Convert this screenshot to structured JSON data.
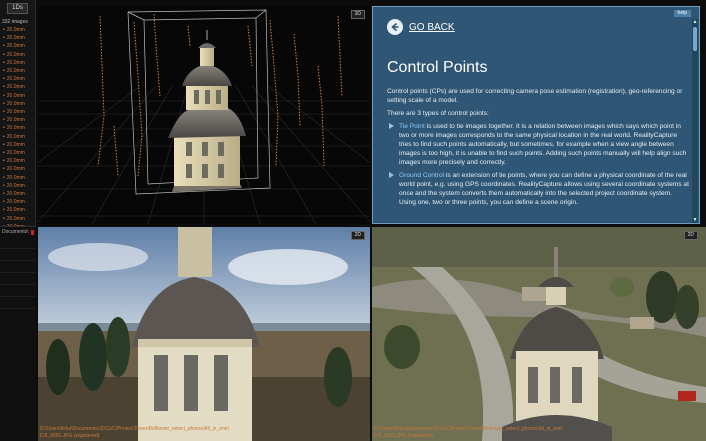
{
  "left_panel": {
    "chip": "1Ds",
    "count": "332 images",
    "images": [
      "20.0mm",
      "20.0mm",
      "20.0mm",
      "20.0mm",
      "20.0mm",
      "20.0mm",
      "20.0mm",
      "20.0mm",
      "20.0mm",
      "20.0mm",
      "20.0mm",
      "20.0mm",
      "20.0mm",
      "20.0mm",
      "20.0mm",
      "20.0mm",
      "20.0mm",
      "20.0mm",
      "20.0mm",
      "20.0mm",
      "20.0mm",
      "20.0mm",
      "20.0mm",
      "20.0mm",
      "20.0mm"
    ],
    "bottom_path": "Documents\\"
  },
  "views": {
    "top_left": {
      "badge": "3D"
    },
    "bottom_left": {
      "badge": "2D",
      "caption_path": "D:\\Users\\Ilkka\\Documents\\3DCaC\\Photos\\Tower\\Belltower_select_photos\\All_in_one\\",
      "caption_file": "DJI_0081.JPG (registered)"
    },
    "bottom_right": {
      "badge": "2D",
      "caption_path": "D:\\Users\\Ilkka\\Documents\\3DCaC\\Photos\\Tower\\Belltower_select_photos\\All_in_one\\",
      "caption_file": "DJI_0112.JPG (registered)"
    }
  },
  "help": {
    "tab": "help",
    "go_back": "GO BACK",
    "title": "Control Points",
    "intro": "Control points (CPs) are used for correcting camera pose estimation (registration), geo-referencing or setting scale of a model.",
    "types_intro": "There are 3 types of control points:",
    "items": [
      {
        "term": "Tie Point",
        "text": " is used to tie images together. It is a relation between images which says which point in two or more images corresponds to the same physical location in the real world. RealityCapture tries to find such points automatically, but sometimes, for example when a view angle between images is too high, it is unable to find such points. Adding such points manually will help align such images more precisely and correctly."
      },
      {
        "term": "Ground Control",
        "text": " is an extension of tie points, where you can define a physical coordinate of the real world point, e.g. using GPS coordinates. RealityCapture allows using several coordinate systems at once and the system converts them automatically into the selected project coordinate system. Using one, two or three points, you can define a scene origin."
      }
    ]
  }
}
